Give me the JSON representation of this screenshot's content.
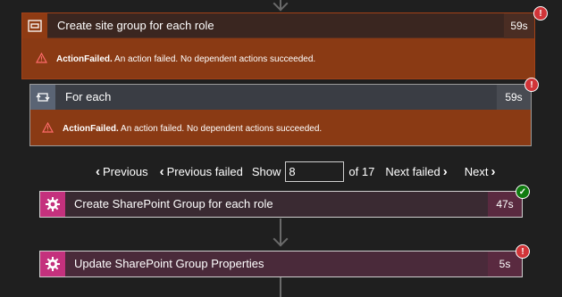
{
  "scope": {
    "title": "Create site group for each role",
    "duration": "59s",
    "status": "!",
    "error_code": "ActionFailed.",
    "error_message": " An action failed. No dependent actions succeeded."
  },
  "foreach": {
    "title": "For each",
    "duration": "59s",
    "status": "!",
    "error_code": "ActionFailed.",
    "error_message": " An action failed. No dependent actions succeeded."
  },
  "pager": {
    "previous_label": "Previous",
    "previous_failed_label": "Previous failed",
    "show_label": "Show",
    "current_value": "8",
    "of_label": "of 17",
    "next_failed_label": "Next failed",
    "next_label": "Next"
  },
  "actions": [
    {
      "title": "Create SharePoint Group for each role",
      "duration": "47s",
      "status": "✓"
    },
    {
      "title": "Update SharePoint Group Properties",
      "duration": "5s",
      "status": "!"
    }
  ],
  "colors": {
    "scope_error_bg": "#8a3a14",
    "action_accent": "#c4317d",
    "error_badge": "#d13438",
    "success_badge": "#107c10"
  },
  "icons": {
    "scope": "scope-icon",
    "foreach": "loop-icon",
    "action": "sharepoint-gear-icon",
    "warning": "warning-triangle-icon"
  }
}
